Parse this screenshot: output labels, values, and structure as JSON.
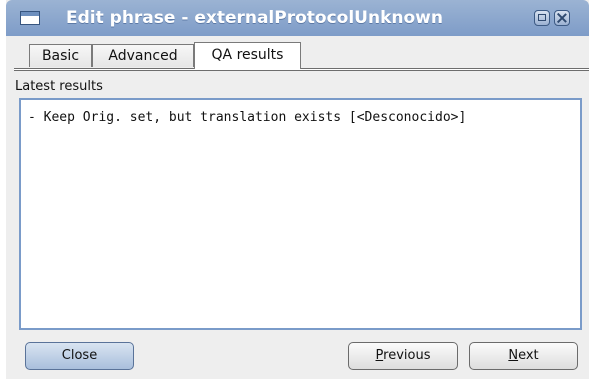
{
  "window": {
    "title": "Edit phrase - externalProtocolUnknown"
  },
  "tabs": [
    {
      "label": "Basic",
      "selected": false
    },
    {
      "label": "Advanced",
      "selected": false
    },
    {
      "label": "QA results",
      "selected": true
    }
  ],
  "results": {
    "label": "Latest results",
    "text": "- Keep Orig. set, but translation exists [<Desconocido>]"
  },
  "buttons": {
    "close": "Close",
    "previous_mnemonic": "P",
    "previous_rest": "revious",
    "next_mnemonic": "N",
    "next_rest": "ext"
  },
  "colors": {
    "titlebar": "#7e9cc8",
    "title_text": "#ffffff",
    "results_border": "#7a9bc9",
    "window_bg": "#eeeeee"
  },
  "icons": [
    "window-menu-icon",
    "maximize-icon",
    "close-icon"
  ]
}
